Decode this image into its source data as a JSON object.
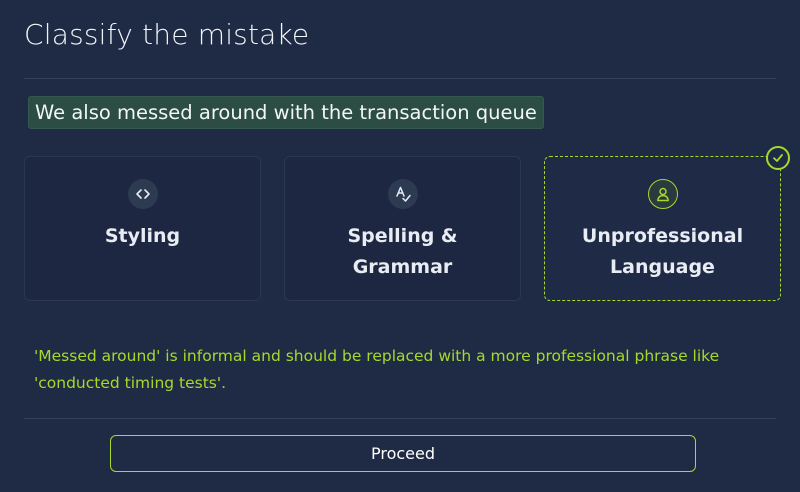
{
  "header": {
    "title": "Classify the mistake"
  },
  "sentence": {
    "text": "We also messed around with the transaction queue"
  },
  "options": [
    {
      "label": "Styling",
      "icon": "code-brackets-icon",
      "selected": false
    },
    {
      "label": "Spelling & Grammar",
      "icon": "spellcheck-icon",
      "selected": false
    },
    {
      "label_line1": "Unprofessional",
      "label_line2": "Language",
      "icon": "user-icon",
      "selected": true
    }
  ],
  "feedback": {
    "text": "'Messed around' is informal and should be replaced with a more professional phrase like 'conducted timing tests'."
  },
  "actions": {
    "proceed_label": "Proceed"
  },
  "colors": {
    "background": "#1f2a44",
    "accent": "#a6d92b",
    "highlight": "#2b4d44"
  }
}
